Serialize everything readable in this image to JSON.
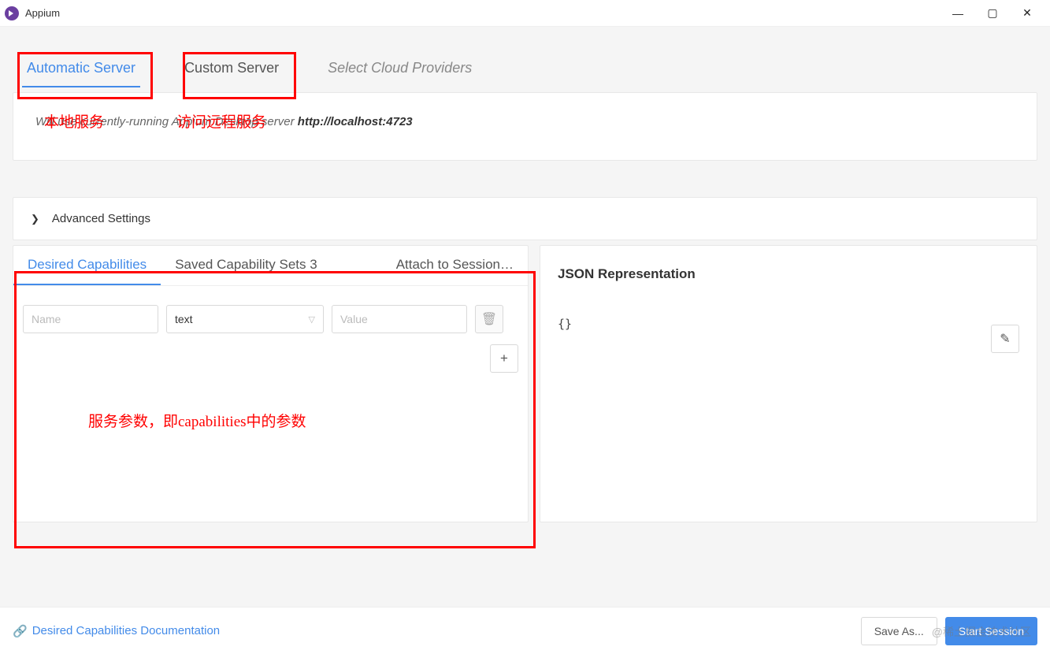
{
  "window": {
    "title": "Appium"
  },
  "server_tabs": {
    "automatic": "Automatic Server",
    "custom": "Custom Server",
    "cloud": "Select Cloud Providers"
  },
  "annotations": {
    "local_service": "本地服务",
    "remote_service": "访问远程服务",
    "caps_note": "服务参数，即capabilities中的参数"
  },
  "server_panel": {
    "desc_prefix": "Will use currently-running Appium Desktop server ",
    "server_url": "http://localhost:4723"
  },
  "advanced": {
    "label": "Advanced Settings"
  },
  "caps_tabs": {
    "desired": "Desired Capabilities",
    "saved": "Saved Capability Sets 3",
    "attach": "Attach to Session…"
  },
  "cap_row": {
    "name_placeholder": "Name",
    "type_value": "text",
    "value_placeholder": "Value"
  },
  "json_panel": {
    "title": "JSON Representation",
    "body": "{}"
  },
  "footer": {
    "doc_link": "Desired Capabilities Documentation",
    "save_as": "Save As...",
    "start_session": "Start Session"
  },
  "watermark": "@稀土掘金技术社区"
}
